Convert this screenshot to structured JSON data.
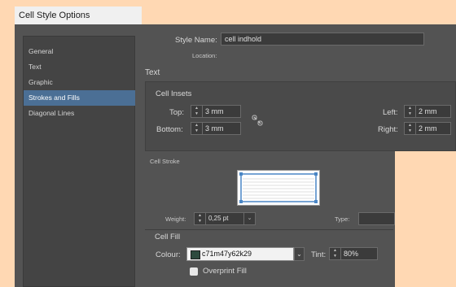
{
  "window": {
    "title": "Cell Style Options"
  },
  "sidebar": {
    "items": [
      {
        "label": "General"
      },
      {
        "label": "Text"
      },
      {
        "label": "Graphic"
      },
      {
        "label": "Strokes and Fills",
        "active": true
      },
      {
        "label": "Diagonal Lines"
      }
    ]
  },
  "style": {
    "name_label": "Style Name:",
    "name_value": "cell indhold",
    "location_label": "Location:"
  },
  "text_section": {
    "heading": "Text",
    "insets_heading": "Cell Insets",
    "top_label": "Top:",
    "top_value": "3 mm",
    "bottom_label": "Bottom:",
    "bottom_value": "3 mm",
    "left_label": "Left:",
    "left_value": "2 mm",
    "right_label": "Right:",
    "right_value": "2 mm",
    "link_icon": "chain-link-broken-icon"
  },
  "stroke_section": {
    "heading": "Cell Stroke",
    "weight_label": "Weight:",
    "weight_value": "0,25 pt",
    "type_label": "Type:"
  },
  "fill_section": {
    "heading": "Cell Fill",
    "colour_label": "Colour:",
    "colour_value": "c71m47y62k29",
    "colour_swatch": "#2f4a3e",
    "tint_label": "Tint:",
    "tint_value": "80%",
    "overprint_label": "Overprint Fill"
  },
  "colors": {
    "accent": "#4b6f95",
    "panel": "#535353",
    "background": "#ffd8b3"
  }
}
